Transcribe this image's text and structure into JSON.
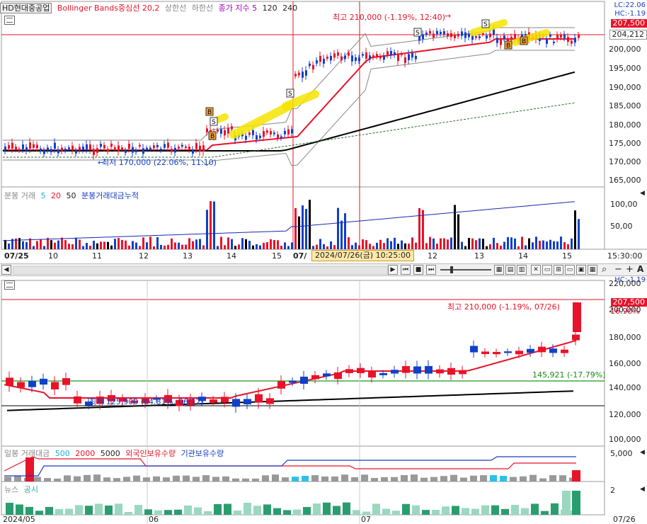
{
  "top": {
    "stock_name": "HD현대중공업",
    "indicator_name": "Bollinger Bands중심선 20,2",
    "upper_band_label": "상한선",
    "lower_band_label": "하한선",
    "close_index_label": "종가 지수 5",
    "ma_120": "120",
    "ma_240": "240",
    "lc_label": "LC:22.06",
    "hc_label": "HC:-1.19",
    "current_price": "207,500",
    "reference_price": "204,212",
    "high_annotation": "최고 210,000 (-1.19%, 12:40)",
    "low_annotation": "최저 170,000 (22.06%, 11:10)",
    "y_ticks": [
      "200,000",
      "195,000",
      "190,000",
      "185,000",
      "180,000",
      "175,000",
      "170,000",
      "165,000"
    ],
    "volume_title": "분봉 거래",
    "vol_ma_5": "5",
    "vol_ma_20": "20",
    "vol_ma_50": "50",
    "volume_cumulative": "분봉거래대금누적",
    "volume_ticks": [
      "100,00",
      "50,00"
    ],
    "x_ticks": [
      "07/25",
      "10",
      "11",
      "12",
      "13",
      "14",
      "15",
      "07/",
      "12",
      "13",
      "14",
      "15"
    ],
    "time_tip": "2024/07/26(금) 10:25:00",
    "clock": "15:30:00",
    "signals": [
      "B",
      "S",
      "B",
      "S",
      "S",
      "B",
      "B"
    ]
  },
  "toolbar_icons": [
    "scroll-left-icon",
    "prev-end-icon",
    "pause-icon",
    "next-end-icon",
    "zoom-slider-icon",
    "grid-icon",
    "layout-icon",
    "chart-icon",
    "chart-icon",
    "tool-icon",
    "tool-icon",
    "tool-icon",
    "tool-icon",
    "tool-icon",
    "search-icon",
    "minus-icon",
    "plus-icon",
    "font-icon"
  ],
  "bottom": {
    "hc_label": "HC:-1.19",
    "current_price": "207,500",
    "change_pct": "16.90%",
    "high_annotation": "최고 210,000 (-1.19%, 07/26)",
    "low_annotation": "최저 125,900 (64.81%, 06/12)",
    "support_label": "145,921 (-17.79%)",
    "y_ticks": [
      "220,000",
      "200,000",
      "180,000",
      "160,000",
      "140,000",
      "120,000",
      "100,000"
    ],
    "volume_title": "일봉 거래대금",
    "vol_ma_500": "500",
    "vol_ma_2000": "2000",
    "vol_ma_5000": "5000",
    "foreign_label": "외국인보유수량",
    "inst_label": "기관보유수량",
    "volume_tick": "5,000",
    "news_label": "뉴스",
    "disclosure_label": "공시",
    "news_tick": "2",
    "x_ticks": [
      "2024/05",
      "06",
      "07"
    ],
    "date_end": "07/26"
  },
  "colors": {
    "up": "#e8132a",
    "down": "#1040c8",
    "ma_black": "#000000",
    "ma_red": "#e8132a",
    "band": "#777777",
    "highlight": "#f5e400",
    "teal": "#2a9d6e"
  }
}
